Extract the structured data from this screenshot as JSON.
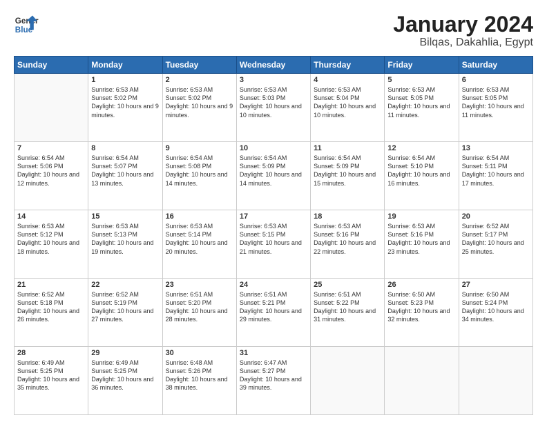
{
  "header": {
    "logo_line1": "General",
    "logo_line2": "Blue",
    "title": "January 2024",
    "subtitle": "Bilqas, Dakahlia, Egypt"
  },
  "days_of_week": [
    "Sunday",
    "Monday",
    "Tuesday",
    "Wednesday",
    "Thursday",
    "Friday",
    "Saturday"
  ],
  "weeks": [
    [
      {
        "day": "",
        "empty": true
      },
      {
        "day": "1",
        "sunrise": "6:53 AM",
        "sunset": "5:02 PM",
        "daylight": "10 hours and 9 minutes."
      },
      {
        "day": "2",
        "sunrise": "6:53 AM",
        "sunset": "5:02 PM",
        "daylight": "10 hours and 9 minutes."
      },
      {
        "day": "3",
        "sunrise": "6:53 AM",
        "sunset": "5:03 PM",
        "daylight": "10 hours and 10 minutes."
      },
      {
        "day": "4",
        "sunrise": "6:53 AM",
        "sunset": "5:04 PM",
        "daylight": "10 hours and 10 minutes."
      },
      {
        "day": "5",
        "sunrise": "6:53 AM",
        "sunset": "5:05 PM",
        "daylight": "10 hours and 11 minutes."
      },
      {
        "day": "6",
        "sunrise": "6:53 AM",
        "sunset": "5:05 PM",
        "daylight": "10 hours and 11 minutes."
      }
    ],
    [
      {
        "day": "7",
        "sunrise": "6:54 AM",
        "sunset": "5:06 PM",
        "daylight": "10 hours and 12 minutes."
      },
      {
        "day": "8",
        "sunrise": "6:54 AM",
        "sunset": "5:07 PM",
        "daylight": "10 hours and 13 minutes."
      },
      {
        "day": "9",
        "sunrise": "6:54 AM",
        "sunset": "5:08 PM",
        "daylight": "10 hours and 14 minutes."
      },
      {
        "day": "10",
        "sunrise": "6:54 AM",
        "sunset": "5:09 PM",
        "daylight": "10 hours and 14 minutes."
      },
      {
        "day": "11",
        "sunrise": "6:54 AM",
        "sunset": "5:09 PM",
        "daylight": "10 hours and 15 minutes."
      },
      {
        "day": "12",
        "sunrise": "6:54 AM",
        "sunset": "5:10 PM",
        "daylight": "10 hours and 16 minutes."
      },
      {
        "day": "13",
        "sunrise": "6:54 AM",
        "sunset": "5:11 PM",
        "daylight": "10 hours and 17 minutes."
      }
    ],
    [
      {
        "day": "14",
        "sunrise": "6:53 AM",
        "sunset": "5:12 PM",
        "daylight": "10 hours and 18 minutes."
      },
      {
        "day": "15",
        "sunrise": "6:53 AM",
        "sunset": "5:13 PM",
        "daylight": "10 hours and 19 minutes."
      },
      {
        "day": "16",
        "sunrise": "6:53 AM",
        "sunset": "5:14 PM",
        "daylight": "10 hours and 20 minutes."
      },
      {
        "day": "17",
        "sunrise": "6:53 AM",
        "sunset": "5:15 PM",
        "daylight": "10 hours and 21 minutes."
      },
      {
        "day": "18",
        "sunrise": "6:53 AM",
        "sunset": "5:16 PM",
        "daylight": "10 hours and 22 minutes."
      },
      {
        "day": "19",
        "sunrise": "6:53 AM",
        "sunset": "5:16 PM",
        "daylight": "10 hours and 23 minutes."
      },
      {
        "day": "20",
        "sunrise": "6:52 AM",
        "sunset": "5:17 PM",
        "daylight": "10 hours and 25 minutes."
      }
    ],
    [
      {
        "day": "21",
        "sunrise": "6:52 AM",
        "sunset": "5:18 PM",
        "daylight": "10 hours and 26 minutes."
      },
      {
        "day": "22",
        "sunrise": "6:52 AM",
        "sunset": "5:19 PM",
        "daylight": "10 hours and 27 minutes."
      },
      {
        "day": "23",
        "sunrise": "6:51 AM",
        "sunset": "5:20 PM",
        "daylight": "10 hours and 28 minutes."
      },
      {
        "day": "24",
        "sunrise": "6:51 AM",
        "sunset": "5:21 PM",
        "daylight": "10 hours and 29 minutes."
      },
      {
        "day": "25",
        "sunrise": "6:51 AM",
        "sunset": "5:22 PM",
        "daylight": "10 hours and 31 minutes."
      },
      {
        "day": "26",
        "sunrise": "6:50 AM",
        "sunset": "5:23 PM",
        "daylight": "10 hours and 32 minutes."
      },
      {
        "day": "27",
        "sunrise": "6:50 AM",
        "sunset": "5:24 PM",
        "daylight": "10 hours and 34 minutes."
      }
    ],
    [
      {
        "day": "28",
        "sunrise": "6:49 AM",
        "sunset": "5:25 PM",
        "daylight": "10 hours and 35 minutes."
      },
      {
        "day": "29",
        "sunrise": "6:49 AM",
        "sunset": "5:25 PM",
        "daylight": "10 hours and 36 minutes."
      },
      {
        "day": "30",
        "sunrise": "6:48 AM",
        "sunset": "5:26 PM",
        "daylight": "10 hours and 38 minutes."
      },
      {
        "day": "31",
        "sunrise": "6:47 AM",
        "sunset": "5:27 PM",
        "daylight": "10 hours and 39 minutes."
      },
      {
        "day": "",
        "empty": true
      },
      {
        "day": "",
        "empty": true
      },
      {
        "day": "",
        "empty": true
      }
    ]
  ]
}
